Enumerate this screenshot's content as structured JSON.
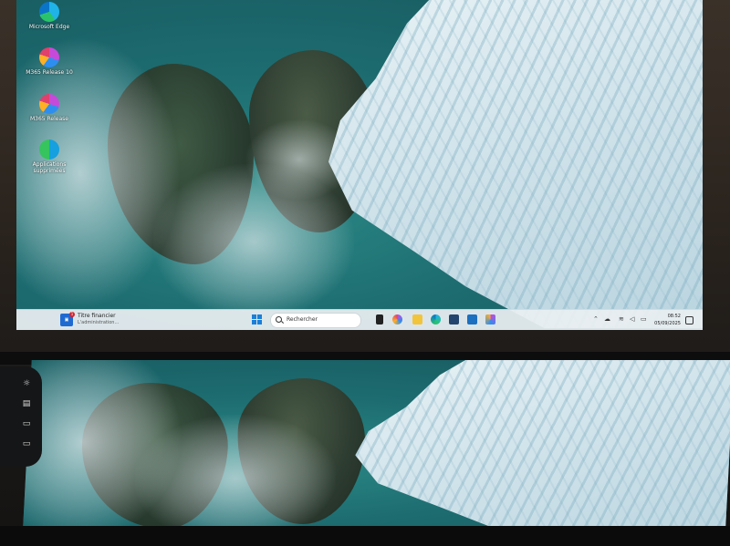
{
  "desktop": {
    "icons": [
      {
        "label": "Microsoft Edge",
        "icon": "edge-icon"
      },
      {
        "label": "M365 Release 10",
        "icon": "m365-icon"
      },
      {
        "label": "M365 Release",
        "icon": "m365-icon"
      },
      {
        "label": "Applications supprimées",
        "icon": "apps-icon"
      }
    ]
  },
  "taskbar": {
    "widget": {
      "badge": "1",
      "title": "Titre financier",
      "subtitle": "L'administration..."
    },
    "search_placeholder": "Rechercher",
    "clock": {
      "time": "08:52",
      "date": "05/09/2025"
    }
  },
  "colors": {
    "taskbar": "#e9eff2",
    "accent": "#1a7fd8"
  }
}
